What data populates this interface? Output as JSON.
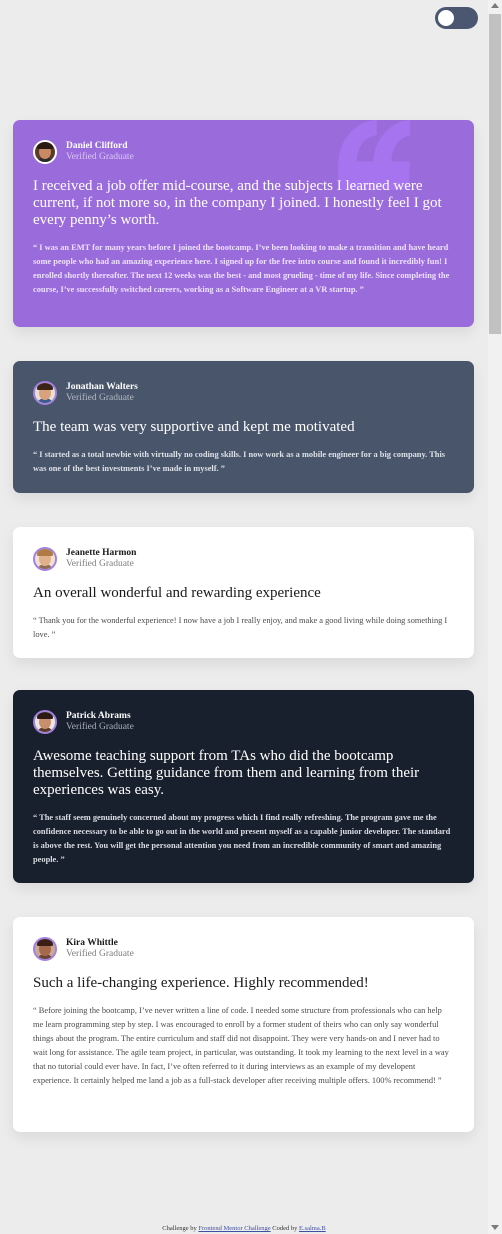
{
  "theme_toggle": {
    "state": "off",
    "track_color": "#4b5670"
  },
  "colors": {
    "page_bg": "#ececec",
    "purple": "#9a6cdb",
    "slate": "#48556a",
    "white": "#ffffff",
    "dark": "#19202d",
    "avatar_ring": "#a382dd"
  },
  "testimonials": [
    {
      "name": "Daniel Clifford",
      "status": "Verified Graduate",
      "headline": "I received a job offer mid-course, and the subjects I learned were current, if not more so, in the company I joined. I honestly feel I got every penny’s worth.",
      "quote": "“ I was an EMT for many years before I joined the bootcamp. I’ve been looking to make a transition and have heard some people who had an amazing experience here. I signed up for the free intro course and found it incredibly fun! I enrolled shortly thereafter. The next 12 weeks was the best - and most grueling - time of my life. Since completing the course, I’ve successfully switched careers, working as a Software Engineer at a VR startup. ”"
    },
    {
      "name": "Jonathan Walters",
      "status": "Verified Graduate",
      "headline": "The team was very supportive and kept me motivated",
      "quote": "“ I started as a total newbie with virtually no coding skills. I now work as a mobile engineer for a big company. This was one of the best investments I’ve made in myself. ”"
    },
    {
      "name": "Jeanette Harmon",
      "status": "Verified Graduate",
      "headline": "An overall wonderful and rewarding experience",
      "quote": "“ Thank you for the wonderful experience! I now have a job I really enjoy, and make a good living while doing something I love. ”"
    },
    {
      "name": "Patrick Abrams",
      "status": "Verified Graduate",
      "headline": "Awesome teaching support from TAs who did the bootcamp themselves. Getting guidance from them and learning from their experiences was easy.",
      "quote": "“ The staff seem genuinely concerned about my progress which I find really refreshing. The program gave me the confidence necessary to be able to go out in the world and present myself as a capable junior developer. The standard is above the rest. You will get the personal attention you need from an incredible community of smart and amazing people. ”"
    },
    {
      "name": "Kira Whittle",
      "status": "Verified Graduate",
      "headline": "Such a life-changing experience. Highly recommended!",
      "quote": "“ Before joining the bootcamp, I’ve never written a line of code. I needed some structure from professionals who can help me learn programming step by step. I was encouraged to enroll by a former student of theirs who can only say wonderful things about the program. The entire curriculum and staff did not disappoint. They were very hands-on and I never had to wait long for assistance. The agile team project, in particular, was outstanding. It took my learning to the next level in a way that no tutorial could ever have. In fact, I’ve often referred to it during interviews as an example of my developent experience. It certainly helped me land a job as a full-stack developer after receiving multiple offers. 100% recommend! ”"
    }
  ],
  "footer": {
    "prefix": "Challenge by",
    "challenge_link": "Frontend Mentor Challenge",
    "middle": "Coded by",
    "author_link": "E.salma.B"
  }
}
